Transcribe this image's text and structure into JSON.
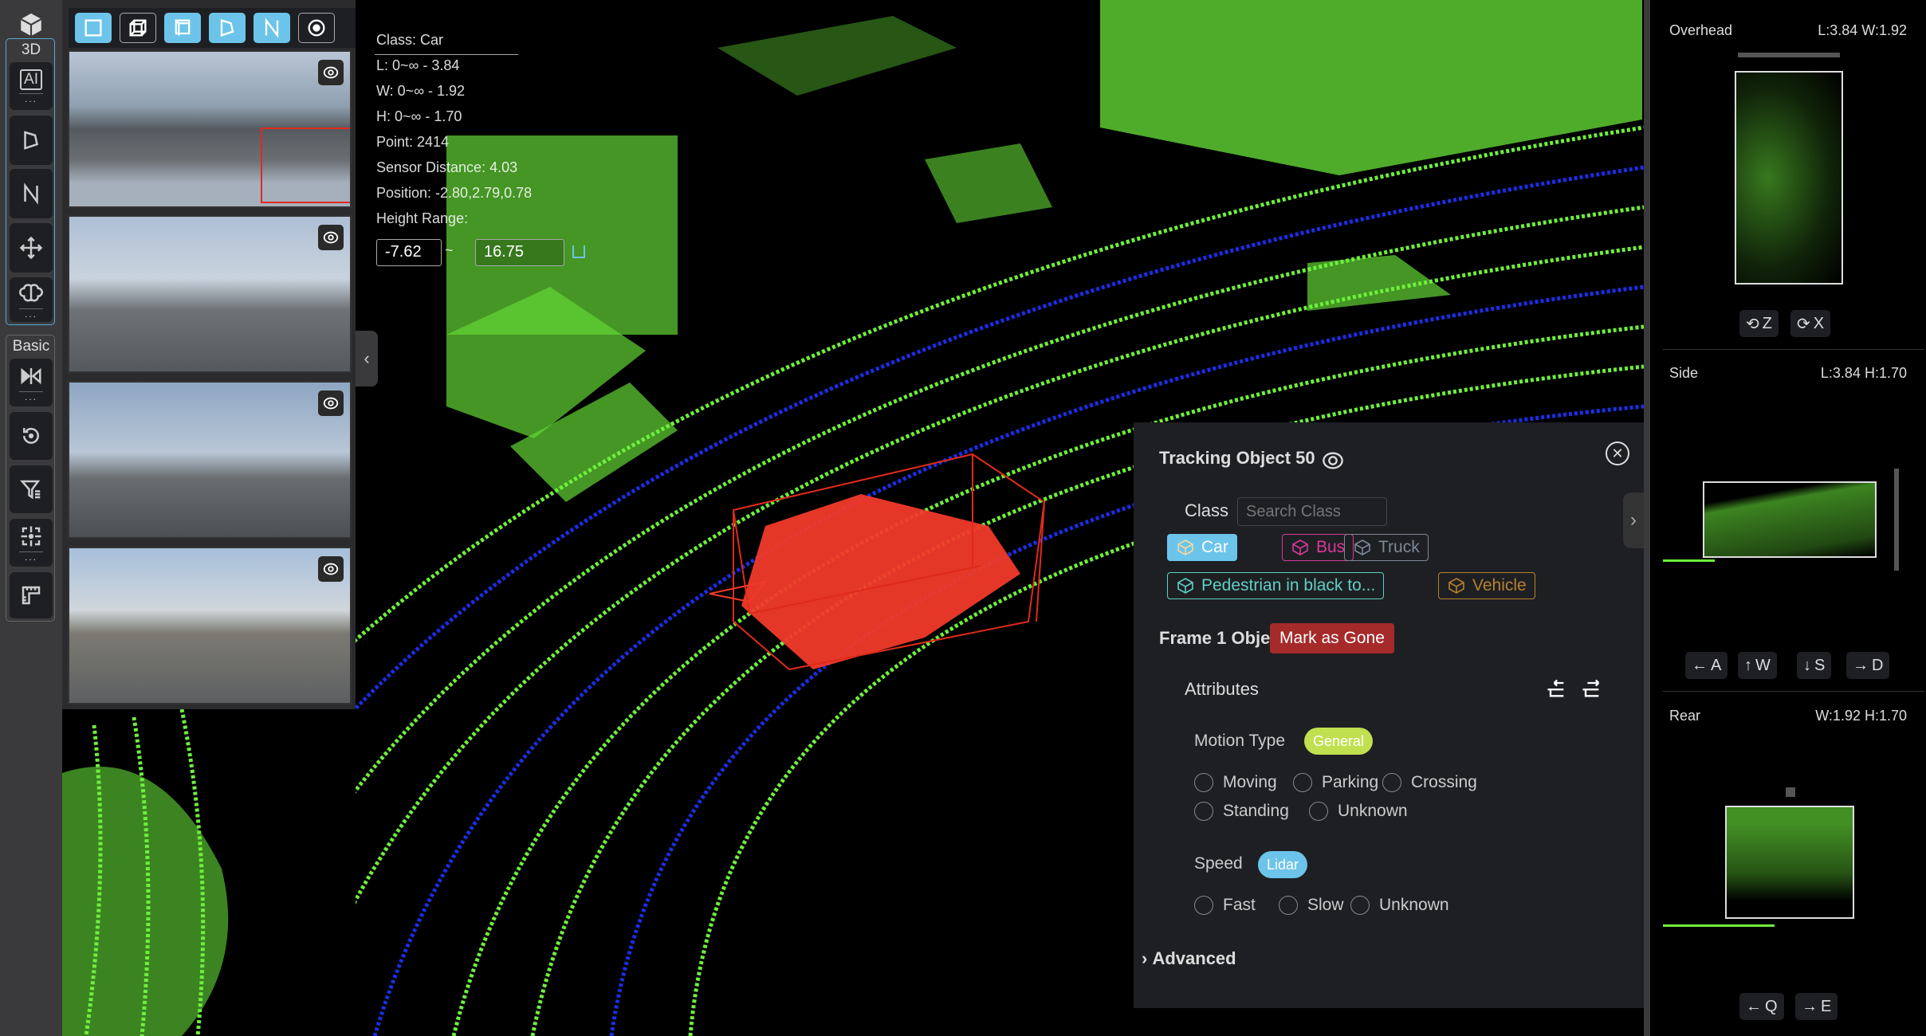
{
  "left_toolbar": {
    "group_3d_label": "3D",
    "group_basic_label": "Basic",
    "tools": [
      {
        "name": "cube-icon"
      },
      {
        "name": "ai-icon",
        "label": "AI"
      },
      {
        "name": "polygon-icon"
      },
      {
        "name": "polyline-icon"
      },
      {
        "name": "move-icon"
      },
      {
        "name": "brain-icon"
      },
      {
        "name": "mirror-icon"
      },
      {
        "name": "reset-icon"
      },
      {
        "name": "filter-icon"
      },
      {
        "name": "focus-icon"
      },
      {
        "name": "ruler-icon"
      }
    ],
    "more_label": "..."
  },
  "top_toolbar": [
    "rect-tool",
    "cuboid-tool",
    "box-tool",
    "polygon-tool",
    "polyline-tool",
    "point-tool"
  ],
  "info_overlay": {
    "class": "Class:  Car",
    "l": "L:  0~∞ - 3.84",
    "w": "W:  0~∞ - 1.92",
    "h": "H:  0~∞ - 1.70",
    "point": "Point:  2414",
    "sensor_distance": "Sensor Distance:  4.03",
    "position": "Position:  -2.80,2.79,0.78",
    "height_range_label": "Height Range:",
    "height_min": "-7.62",
    "height_sep": "~",
    "height_max": "16.75"
  },
  "panel": {
    "title": "Tracking Object 50",
    "class_label": "Class",
    "search_placeholder": "Search Class",
    "classes": [
      {
        "label": "Car",
        "color": "#6cc4ea",
        "selected": true
      },
      {
        "label": "Bus",
        "color": "#d63a9a",
        "selected": false
      },
      {
        "label": "Truck",
        "color": "#7d8896",
        "selected": false
      },
      {
        "label": "Pedestrian in black to...",
        "color": "#5ed0c4",
        "selected": false
      },
      {
        "label": "Vehicle",
        "color": "#b7812e",
        "selected": false
      }
    ],
    "frame_label": "Frame 1 Object",
    "mark_gone": "Mark as Gone",
    "attributes_label": "Attributes",
    "motion_label": "Motion Type",
    "motion_tag": "General",
    "motion_options": [
      "Moving",
      "Parking",
      "Crossing",
      "Standing",
      "Unknown"
    ],
    "speed_label": "Speed",
    "speed_tag": "Lidar",
    "speed_options": [
      "Fast",
      "Slow",
      "Unknown"
    ],
    "advanced_label": "Advanced"
  },
  "right_panel": {
    "overhead": {
      "label": "Overhead",
      "dims": "L:3.84 W:1.92",
      "buttons": [
        "Z",
        "X"
      ]
    },
    "side": {
      "label": "Side",
      "dims": "L:3.84 H:1.70",
      "buttons": [
        "A",
        "W",
        "S",
        "D"
      ]
    },
    "rear": {
      "label": "Rear",
      "dims": "W:1.92 H:1.70",
      "buttons": [
        "Q",
        "E"
      ]
    }
  },
  "colors": {
    "accent": "#6cc4ea",
    "points": "#6ef03c",
    "ground": "#1a2ee6",
    "selected": "#f03a2a",
    "danger": "#a52a2a",
    "general": "#c0e050"
  }
}
